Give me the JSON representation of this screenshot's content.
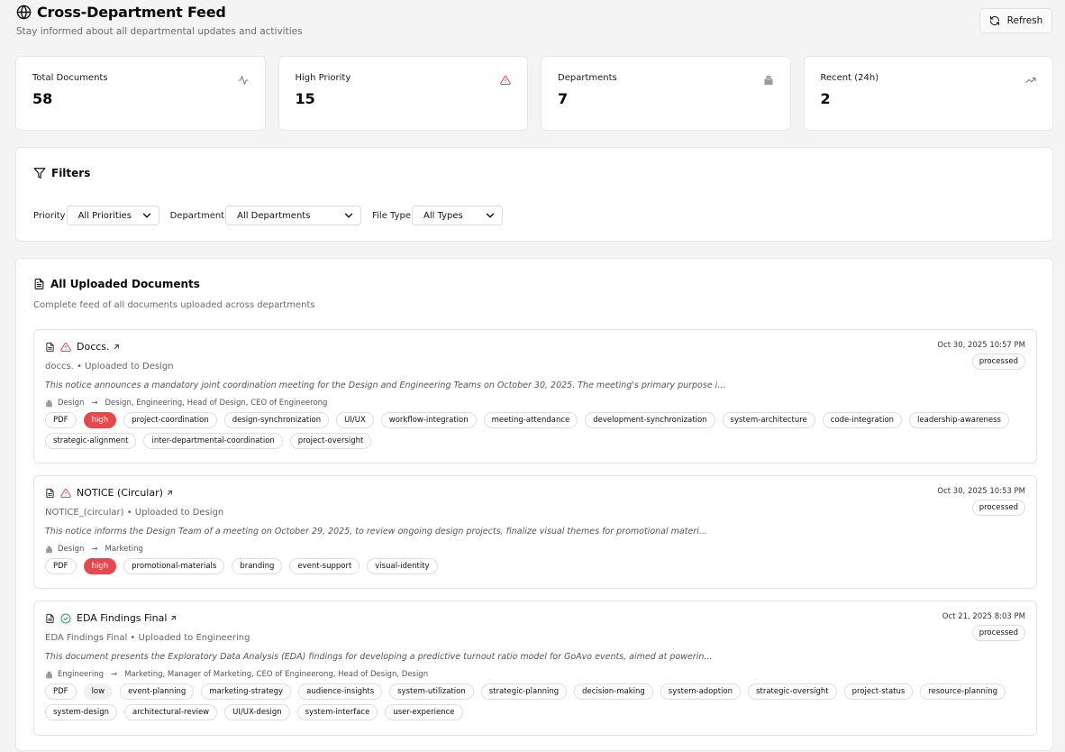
{
  "header": {
    "title": "Cross-Department Feed",
    "subtitle": "Stay informed about all departmental updates and activities",
    "refresh_label": "Refresh"
  },
  "stats": [
    {
      "label": "Total Documents",
      "value": "58",
      "icon": "activity-icon"
    },
    {
      "label": "High Priority",
      "value": "15",
      "icon": "alert-triangle-icon"
    },
    {
      "label": "Departments",
      "value": "7",
      "icon": "building-icon"
    },
    {
      "label": "Recent (24h)",
      "value": "2",
      "icon": "trending-up-icon"
    }
  ],
  "filters": {
    "title": "Filters",
    "priority": {
      "label": "Priority",
      "value": "All Priorities"
    },
    "department": {
      "label": "Department",
      "value": "All Departments"
    },
    "file_type": {
      "label": "File Type",
      "value": "All Types"
    }
  },
  "documents_panel": {
    "title": "All Uploaded Documents",
    "subtitle": "Complete feed of all documents uploaded across departments"
  },
  "documents": [
    {
      "title": "Doccs.",
      "meta": "doccs. • Uploaded to Design",
      "description": "This notice announces a mandatory joint coordination meeting for the Design and Engineering Teams on October 30, 2025. The meeting's primary purpose i...",
      "from": "Design",
      "to": "Design, Engineering, Head of Design, CEO of Engineerong",
      "date": "Oct 30, 2025 10:57 PM",
      "status": "processed",
      "priority": "high",
      "file_type": "PDF",
      "tags": [
        "project-coordination",
        "design-synchronization",
        "UI/UX",
        "workflow-integration",
        "meeting-attendance",
        "development-synchronization",
        "system-architecture",
        "code-integration",
        "leadership-awareness",
        "strategic-alignment",
        "inter-departmental-coordination",
        "project-oversight"
      ]
    },
    {
      "title": "NOTICE (Circular)",
      "meta": "NOTICE_(circular) • Uploaded to Design",
      "description": "This notice informs the Design Team of a meeting on October 29, 2025, to review ongoing design projects, finalize visual themes for promotional materi...",
      "from": "Design",
      "to": "Marketing",
      "date": "Oct 30, 2025 10:53 PM",
      "status": "processed",
      "priority": "high",
      "file_type": "PDF",
      "tags": [
        "promotional-materials",
        "branding",
        "event-support",
        "visual-identity"
      ]
    },
    {
      "title": "EDA Findings Final",
      "meta": "EDA Findings Final • Uploaded to Engineering",
      "description": "This document presents the Exploratory Data Analysis (EDA) findings for developing a predictive turnout ratio model for GoAvo events, aimed at powerin...",
      "from": "Engineering",
      "to": "Marketing, Manager of Marketing, CEO of Engineerong, Head of Design, Design",
      "date": "Oct 21, 2025 8:03 PM",
      "status": "processed",
      "priority": "low",
      "file_type": "PDF",
      "tags": [
        "event-planning",
        "marketing-strategy",
        "audience-insights",
        "system-utilization",
        "strategic-planning",
        "decision-making",
        "system-adoption",
        "strategic-oversight",
        "project-status",
        "resource-planning",
        "system-design",
        "architectural-review",
        "UI/UX-design",
        "system-interface",
        "user-experience"
      ]
    }
  ],
  "colors": {
    "danger": "#e5484d",
    "success": "#22a35a",
    "muted": "#6b6b6b"
  }
}
